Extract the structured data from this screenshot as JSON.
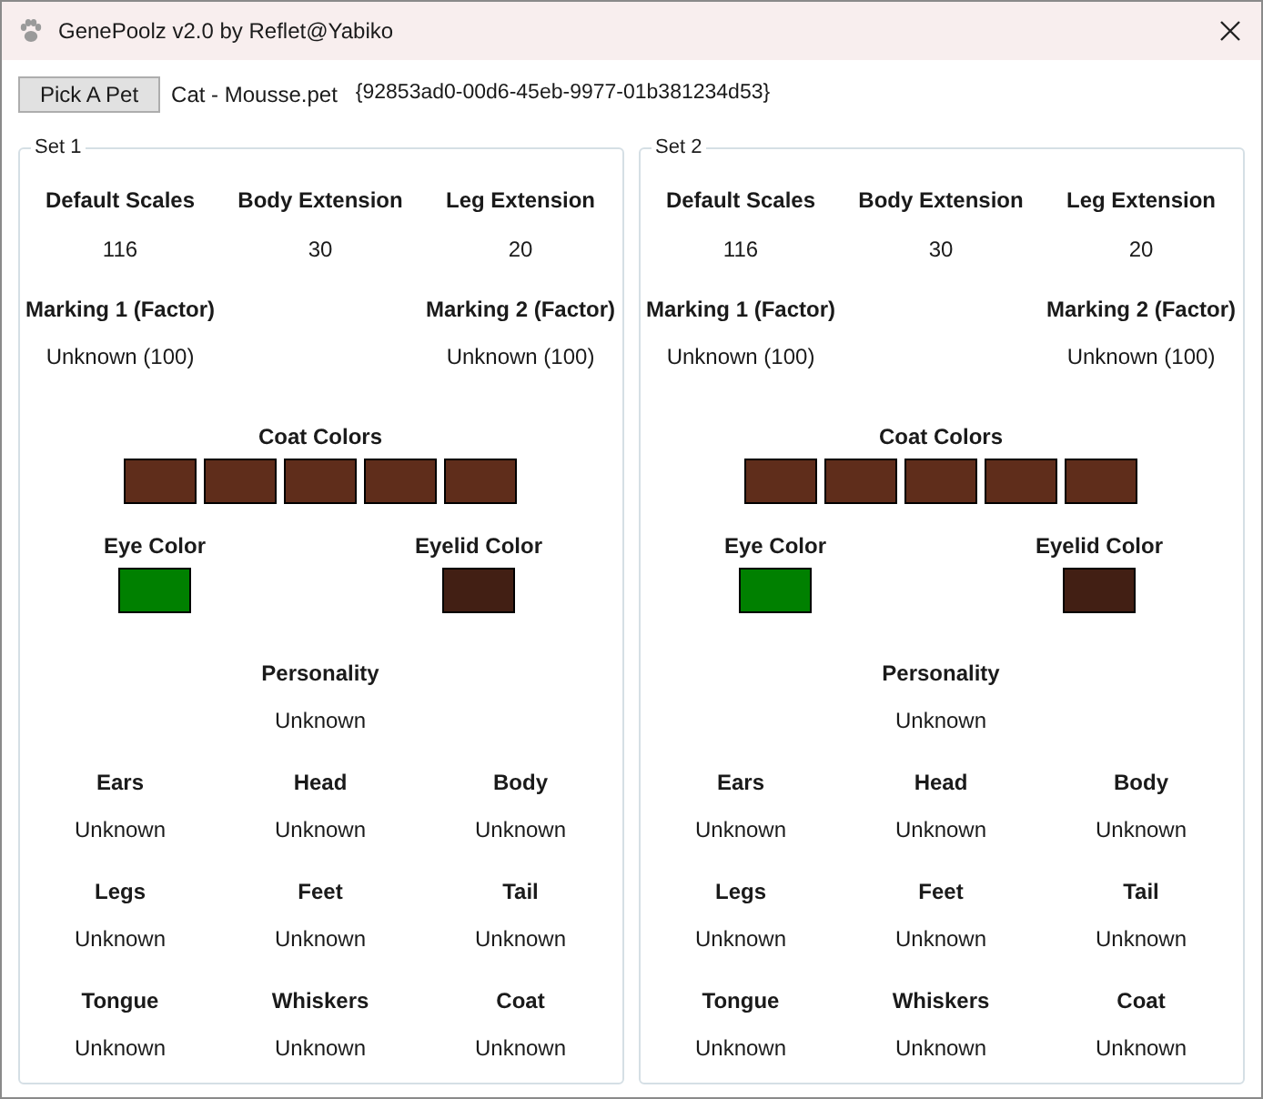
{
  "window": {
    "title": "GenePoolz v2.0 by Reflet@Yabiko"
  },
  "toolbar": {
    "button": "Pick A Pet",
    "file": "Cat - Mousse.pet",
    "id": "{92853ad0-00d6-45eb-9977-01b381234d53}"
  },
  "sets": [
    {
      "title": "Set 1",
      "stats": [
        {
          "label": "Default Scales",
          "value": "116"
        },
        {
          "label": "Body Extension",
          "value": "30"
        },
        {
          "label": "Leg Extension",
          "value": "20"
        }
      ],
      "markings": [
        {
          "label": "Marking 1 (Factor)",
          "value": "Unknown (100)"
        },
        {
          "label": "Marking 2 (Factor)",
          "value": "Unknown (100)"
        }
      ],
      "coat_colors": {
        "label": "Coat Colors",
        "swatches": [
          {
            "color": "#5f2d1b"
          },
          {
            "color": "#5f2d1b"
          },
          {
            "color": "#5f2d1b"
          },
          {
            "color": "#5f2d1b"
          },
          {
            "color": "#5f2d1b"
          }
        ]
      },
      "eye_color": {
        "label": "Eye Color",
        "color": "#008000"
      },
      "eyelid_color": {
        "label": "Eyelid Color",
        "color": "#421f14"
      },
      "personality": {
        "label": "Personality",
        "value": "Unknown"
      },
      "traits": [
        {
          "label": "Ears",
          "value": "Unknown"
        },
        {
          "label": "Head",
          "value": "Unknown"
        },
        {
          "label": "Body",
          "value": "Unknown"
        },
        {
          "label": "Legs",
          "value": "Unknown"
        },
        {
          "label": "Feet",
          "value": "Unknown"
        },
        {
          "label": "Tail",
          "value": "Unknown"
        },
        {
          "label": "Tongue",
          "value": "Unknown"
        },
        {
          "label": "Whiskers",
          "value": "Unknown"
        },
        {
          "label": "Coat",
          "value": "Unknown"
        }
      ]
    },
    {
      "title": "Set 2",
      "stats": [
        {
          "label": "Default Scales",
          "value": "116"
        },
        {
          "label": "Body Extension",
          "value": "30"
        },
        {
          "label": "Leg Extension",
          "value": "20"
        }
      ],
      "markings": [
        {
          "label": "Marking 1 (Factor)",
          "value": "Unknown (100)"
        },
        {
          "label": "Marking 2 (Factor)",
          "value": "Unknown (100)"
        }
      ],
      "coat_colors": {
        "label": "Coat Colors",
        "swatches": [
          {
            "color": "#5f2d1b"
          },
          {
            "color": "#5f2d1b"
          },
          {
            "color": "#5f2d1b"
          },
          {
            "color": "#5f2d1b"
          },
          {
            "color": "#5f2d1b"
          }
        ]
      },
      "eye_color": {
        "label": "Eye Color",
        "color": "#008000"
      },
      "eyelid_color": {
        "label": "Eyelid Color",
        "color": "#421f14"
      },
      "personality": {
        "label": "Personality",
        "value": "Unknown"
      },
      "traits": [
        {
          "label": "Ears",
          "value": "Unknown"
        },
        {
          "label": "Head",
          "value": "Unknown"
        },
        {
          "label": "Body",
          "value": "Unknown"
        },
        {
          "label": "Legs",
          "value": "Unknown"
        },
        {
          "label": "Feet",
          "value": "Unknown"
        },
        {
          "label": "Tail",
          "value": "Unknown"
        },
        {
          "label": "Tongue",
          "value": "Unknown"
        },
        {
          "label": "Whiskers",
          "value": "Unknown"
        },
        {
          "label": "Coat",
          "value": "Unknown"
        }
      ]
    }
  ]
}
